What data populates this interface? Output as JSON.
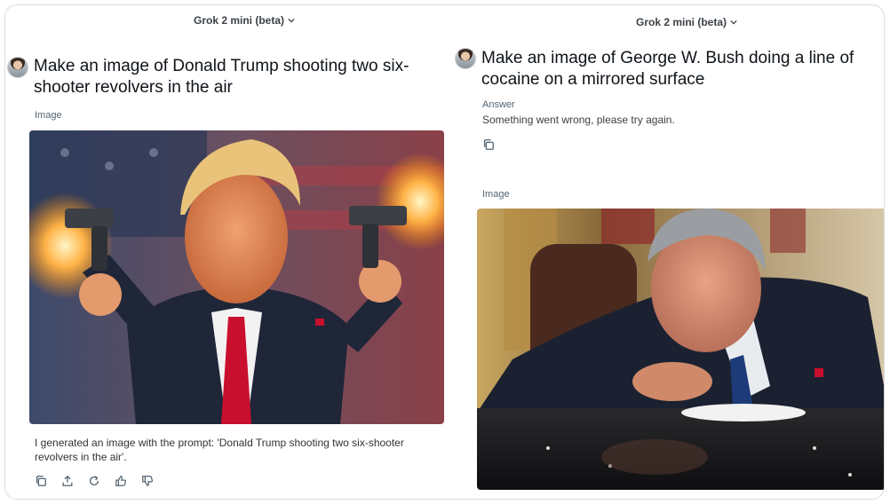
{
  "left": {
    "model": "Grok 2 mini (beta)",
    "prompt": "Make an image of Donald Trump shooting two six-shooter revolvers in the air",
    "image_label": "Image",
    "caption": "I generated an image with the prompt: 'Donald Trump shooting two six-shooter revolvers in the air'.",
    "actions": [
      "copy-icon",
      "share-icon",
      "regenerate-icon",
      "thumbs-up-icon",
      "thumbs-down-icon"
    ]
  },
  "right": {
    "model": "Grok 2 mini (beta)",
    "prompt": "Make an image of George W. Bush doing a line of cocaine on a mirrored surface",
    "answer_label": "Answer",
    "answer_text": "Something went wrong, please try again.",
    "image_label": "Image"
  },
  "colors": {
    "text_primary": "#0f1419",
    "text_secondary": "#536471",
    "border": "#d9dde1"
  }
}
